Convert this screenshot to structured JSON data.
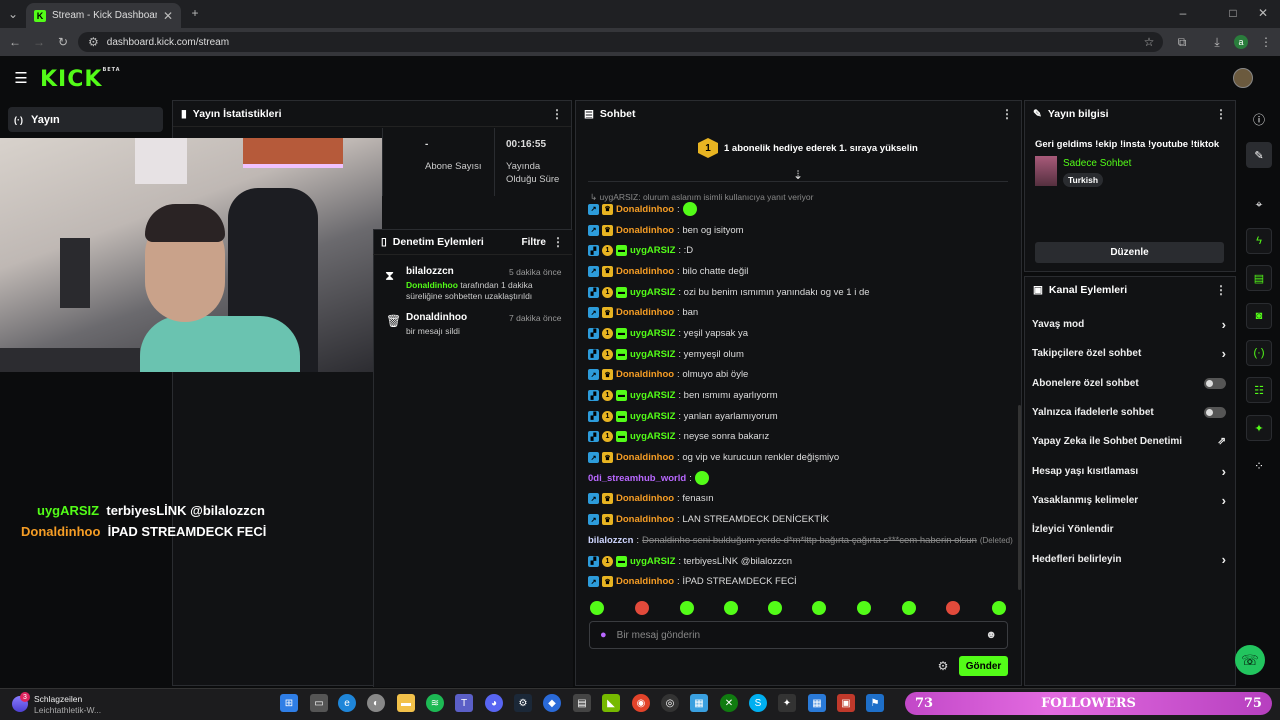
{
  "browser": {
    "tab_title": "Stream - Kick Dashboard",
    "url": "dashboard.kick.com/stream",
    "profile_letter": "a"
  },
  "kick": {
    "logo": "KICK",
    "beta": "BETA"
  },
  "sidebar": {
    "item": "Yayın"
  },
  "stats": {
    "title": "Yayın İstatistikleri",
    "sub_value": "-",
    "sub_label": "Abone Sayısı",
    "time_value": "00:16:55",
    "time_label": "Yayında Olduğu Süre"
  },
  "mod": {
    "title": "Denetim Eylemleri",
    "filter": "Filtre",
    "items": [
      {
        "user": "bilalozzcn",
        "time": "5 dakika önce",
        "actor": "Donaldinhoo",
        "desc": "tarafından 1 dakika süreliğine sohbetten uzaklaştırıldı"
      },
      {
        "user": "Donaldinhoo",
        "time": "7 dakika önce",
        "desc": "bir mesajı sildi"
      }
    ]
  },
  "chat": {
    "title": "Sohbet",
    "promo": "1 abonelik hediye ederek 1. sıraya yükselin",
    "promo_badge": "1",
    "reply": "uygARSIZ: olurum aslanım isimli kullanıcıya yanıt veriyor",
    "messages": [
      {
        "user": "Donaldinhoo",
        "type": "o",
        "text": ":",
        "emote": true
      },
      {
        "user": "Donaldinhoo",
        "type": "o",
        "text": ": ben og isityom"
      },
      {
        "user": "uygARSIZ",
        "type": "g",
        "text": ": :D"
      },
      {
        "user": "Donaldinhoo",
        "type": "o",
        "text": ": bilo chatte değil"
      },
      {
        "user": "uygARSIZ",
        "type": "g",
        "text": ": ozi bu benim ısmımın yanındakı og ve 1 i de"
      },
      {
        "user": "Donaldinhoo",
        "type": "o",
        "text": ": ban"
      },
      {
        "user": "uygARSIZ",
        "type": "g",
        "text": ": yeşil yapsak ya"
      },
      {
        "user": "uygARSIZ",
        "type": "g",
        "text": ": yemyeşil olum"
      },
      {
        "user": "Donaldinhoo",
        "type": "o",
        "text": ": olmuyo abi öyle"
      },
      {
        "user": "uygARSIZ",
        "type": "g",
        "text": ": ben ısmımı ayarlıyorm"
      },
      {
        "user": "uygARSIZ",
        "type": "g",
        "text": ": yanları ayarlamıyorum"
      },
      {
        "user": "uygARSIZ",
        "type": "g",
        "text": ": neyse sonra bakarız"
      },
      {
        "user": "Donaldinhoo",
        "type": "o",
        "text": ": og vip ve kurucuun renkler değişmiyo"
      },
      {
        "user": "0di_streamhub_world",
        "type": "p",
        "text": ":",
        "emote": true
      },
      {
        "user": "Donaldinhoo",
        "type": "o",
        "text": ": fenasın"
      },
      {
        "user": "Donaldinhoo",
        "type": "o",
        "text": ": LAN STREAMDECK DENİCEKTİK"
      },
      {
        "user": "bilalozzcn",
        "type": "bl",
        "text": ":",
        "deleted_text": "Donaldinho seni bulduğum yerde d*m*lttp bağırta çağırta s***cem haberin olsun",
        "deleted_tag": "(Deleted)"
      },
      {
        "user": "uygARSIZ",
        "type": "g",
        "text": ": terbiyesLİNK @bilalozzcn"
      },
      {
        "user": "Donaldinhoo",
        "type": "o",
        "text": ": İPAD STREAMDECK FECİ"
      }
    ],
    "input_placeholder": "Bir mesaj gönderin",
    "send": "Gönder"
  },
  "info": {
    "title": "Yayın bilgisi",
    "stream_title": "Geri geldims !ekip !insta !youtube !tiktok",
    "category": "Sadece Sohbet",
    "language": "Turkish",
    "edit": "Düzenle"
  },
  "actions": {
    "title": "Kanal Eylemleri",
    "rows": [
      {
        "label": "Yavaş mod",
        "ctrl": "chev"
      },
      {
        "label": "Takipçilere özel sohbet",
        "ctrl": "chev"
      },
      {
        "label": "Abonelere özel sohbet",
        "ctrl": "tog"
      },
      {
        "label": "Yalnızca ifadelerle sohbet",
        "ctrl": "tog"
      },
      {
        "label": "Yapay Zeka ile Sohbet Denetimi",
        "ctrl": "ext"
      },
      {
        "label": "Hesap yaşı kısıtlaması",
        "ctrl": "chev"
      },
      {
        "label": "Yasaklanmış kelimeler",
        "ctrl": "chev"
      },
      {
        "label": "İzleyici Yönlendir",
        "ctrl": "none"
      },
      {
        "label": "Hedefleri belirleyin",
        "ctrl": "chev"
      }
    ]
  },
  "overlay": {
    "line1_user": "uygARSIZ",
    "line1_text": "terbiyesLİNK @bilalozzcn",
    "line2_user": "Donaldinhoo",
    "line2_text": "İPAD STREAMDECK FECİ"
  },
  "taskbar": {
    "news_title": "Schlagzeilen",
    "news_sub": "Leichtathletik-W...",
    "news_badge": "3"
  },
  "followers": {
    "left": "73",
    "label": "FOLLOWERS",
    "right": "75"
  }
}
